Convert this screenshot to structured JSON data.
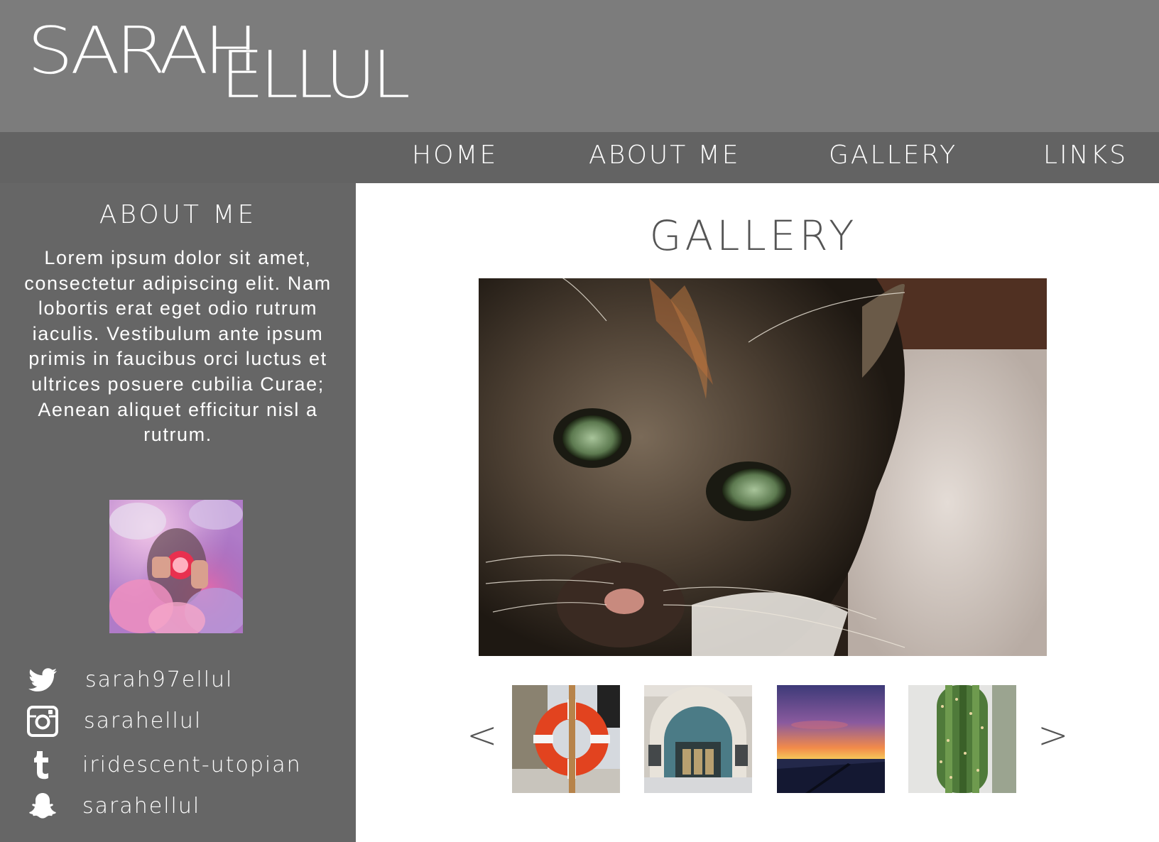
{
  "header": {
    "logo_first": "SARAH",
    "logo_last": "ELLUL"
  },
  "nav": {
    "items": [
      "HOME",
      "ABOUT ME",
      "GALLERY",
      "LINKS"
    ]
  },
  "sidebar": {
    "title": "ABOUT ME",
    "text": "Lorem ipsum dolor sit amet, consectetur adipiscing elit. Nam lobortis erat eget odio rutrum iaculis. Vestibulum ante ipsum primis in faucibus orci luctus et ultrices posuere cubilia Curae; Aenean aliquet efficitur nisl a rutrum.",
    "social": [
      {
        "icon": "twitter-icon",
        "label": "sarah97ellul"
      },
      {
        "icon": "instagram-icon",
        "label": "sarahellul"
      },
      {
        "icon": "tumblr-icon",
        "label": "iridescent-utopian"
      },
      {
        "icon": "snapchat-icon",
        "label": "sarahellul"
      }
    ]
  },
  "main": {
    "title": "GALLERY",
    "prev": "<",
    "next": ">"
  },
  "colors": {
    "header_bg": "#7c7c7c",
    "nav_bg": "#636363",
    "sidebar_bg": "#666666",
    "content_bg": "#ffffff",
    "text_light": "#ffffff",
    "text_dark": "#555555"
  }
}
